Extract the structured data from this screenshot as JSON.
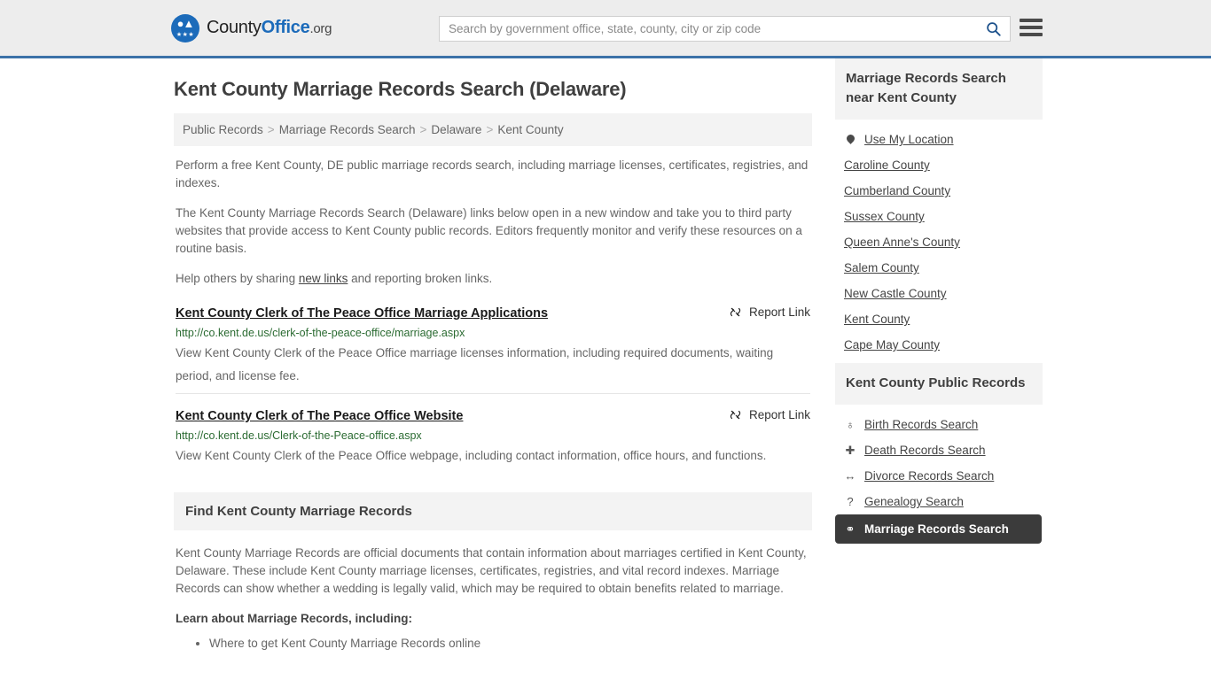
{
  "header": {
    "logo": {
      "part1": "County",
      "part2": "Office",
      "part3": ".org",
      "icon_name": "eagle-seal-icon"
    },
    "search": {
      "placeholder": "Search by government office, state, county, city or zip code",
      "value": "",
      "search_icon": "search-icon"
    },
    "menu_icon": "hamburger-menu-icon"
  },
  "page": {
    "title": "Kent County Marriage Records Search (Delaware)"
  },
  "breadcrumb": {
    "separator": ">",
    "items": [
      {
        "label": "Public Records"
      },
      {
        "label": "Marriage Records Search"
      },
      {
        "label": "Delaware"
      },
      {
        "label": "Kent County"
      }
    ]
  },
  "intro": {
    "paragraph1": "Perform a free Kent County, DE public marriage records search, including marriage licenses, certificates, registries, and indexes.",
    "paragraph2": "The Kent County Marriage Records Search (Delaware) links below open in a new window and take you to third party websites that provide access to Kent County public records. Editors frequently monitor and verify these resources on a routine basis.",
    "share_prefix": "Help others by sharing ",
    "share_link": "new links",
    "share_suffix": " and reporting broken links."
  },
  "results": [
    {
      "title": "Kent County Clerk of The Peace Office Marriage Applications",
      "url": "http://co.kent.de.us/clerk-of-the-peace-office/marriage.aspx",
      "description": "View Kent County Clerk of the Peace Office marriage licenses information, including required documents, waiting period, and license fee.",
      "report_label": "Report Link",
      "report_icon": "broken-link-icon"
    },
    {
      "title": "Kent County Clerk of The Peace Office Website",
      "url": "http://co.kent.de.us/Clerk-of-the-Peace-office.aspx",
      "description": "View Kent County Clerk of the Peace Office webpage, including contact information, office hours, and functions.",
      "report_label": "Report Link",
      "report_icon": "broken-link-icon"
    }
  ],
  "find_section": {
    "heading": "Find Kent County Marriage Records",
    "body": "Kent County Marriage Records are official documents that contain information about marriages certified in Kent County, Delaware. These include Kent County marriage licenses, certificates, registries, and vital record indexes. Marriage Records can show whether a wedding is legally valid, which may be required to obtain benefits related to marriage.",
    "learn_heading": "Learn about Marriage Records, including:",
    "bullets": [
      "Where to get Kent County Marriage Records online"
    ]
  },
  "sidebar": {
    "nearby": {
      "heading": "Marriage Records Search near Kent County",
      "items": [
        {
          "label": "Use My Location",
          "icon": "map-pin-icon",
          "has_icon": true
        },
        {
          "label": "Caroline County",
          "icon": "",
          "has_icon": false
        },
        {
          "label": "Cumberland County",
          "icon": "",
          "has_icon": false
        },
        {
          "label": "Sussex County",
          "icon": "",
          "has_icon": false
        },
        {
          "label": "Queen Anne's County",
          "icon": "",
          "has_icon": false
        },
        {
          "label": "Salem County",
          "icon": "",
          "has_icon": false
        },
        {
          "label": "New Castle County",
          "icon": "",
          "has_icon": false
        },
        {
          "label": "Kent County",
          "icon": "",
          "has_icon": false
        },
        {
          "label": "Cape May County",
          "icon": "",
          "has_icon": false
        }
      ]
    },
    "public_records": {
      "heading": "Kent County Public Records",
      "items": [
        {
          "label": "Birth Records Search",
          "icon": "baby-icon",
          "glyph": "♁",
          "active": false
        },
        {
          "label": "Death Records Search",
          "icon": "cross-icon",
          "glyph": "✚",
          "active": false
        },
        {
          "label": "Divorce Records Search",
          "icon": "split-arrows-icon",
          "glyph": "↔",
          "active": false
        },
        {
          "label": "Genealogy Search",
          "icon": "question-mark-icon",
          "glyph": "?",
          "active": false
        },
        {
          "label": "Marriage Records Search",
          "icon": "rings-icon",
          "glyph": "⚭",
          "active": true
        }
      ]
    }
  },
  "colors": {
    "brand_blue": "#1c6bba",
    "header_border": "#3c72a8",
    "header_bg": "#ededed",
    "panel_bg": "#f3f3f3",
    "url_green": "#2b6b32",
    "active_dark": "#3b3b3b"
  }
}
